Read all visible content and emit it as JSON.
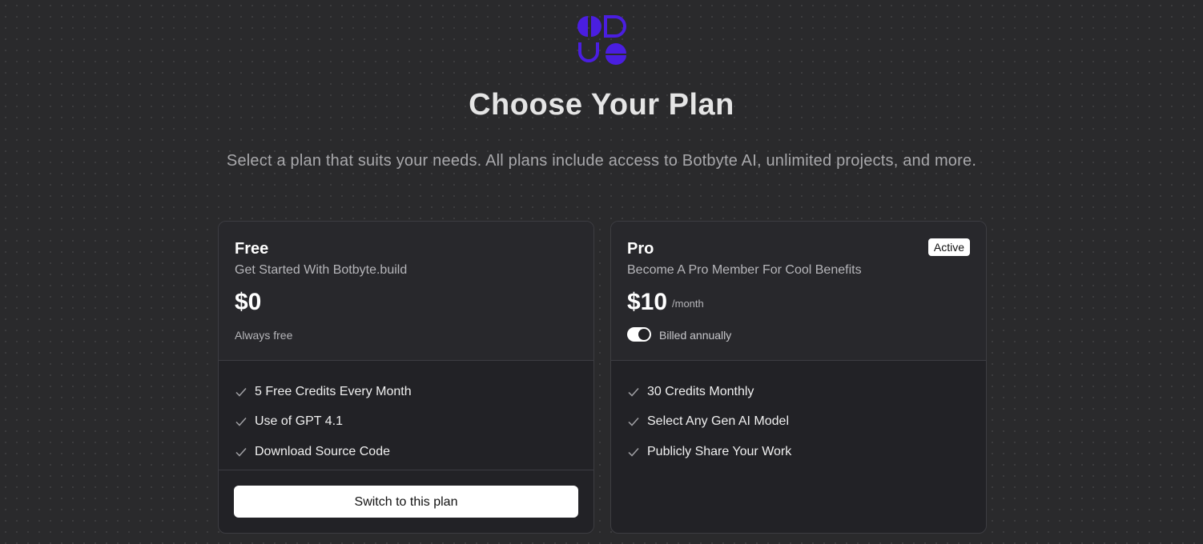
{
  "header": {
    "logo_icon": "botbyte-logo",
    "title": "Choose Your Plan",
    "subtitle": "Select a plan that suits your needs. All plans include access to Botbyte AI, unlimited projects, and more."
  },
  "colors": {
    "background": "#2a2a2c",
    "logo": "#4a1ee0",
    "card": "#222226"
  },
  "plans": [
    {
      "name": "Free",
      "description": "Get Started With Botbyte.build",
      "price": "$0",
      "note": "Always free",
      "features": [
        "5 Free Credits Every Month",
        "Use of GPT 4.1",
        "Download Source Code"
      ],
      "cta_label": "Switch to this plan"
    },
    {
      "name": "Pro",
      "badge": "Active",
      "description": "Become A Pro Member For Cool Benefits",
      "price": "$10",
      "period": "/month",
      "billing_label": "Billed annually",
      "billing_toggle_on": true,
      "features": [
        "30 Credits Monthly",
        "Select Any Gen AI Model",
        "Publicly Share Your Work"
      ]
    }
  ]
}
